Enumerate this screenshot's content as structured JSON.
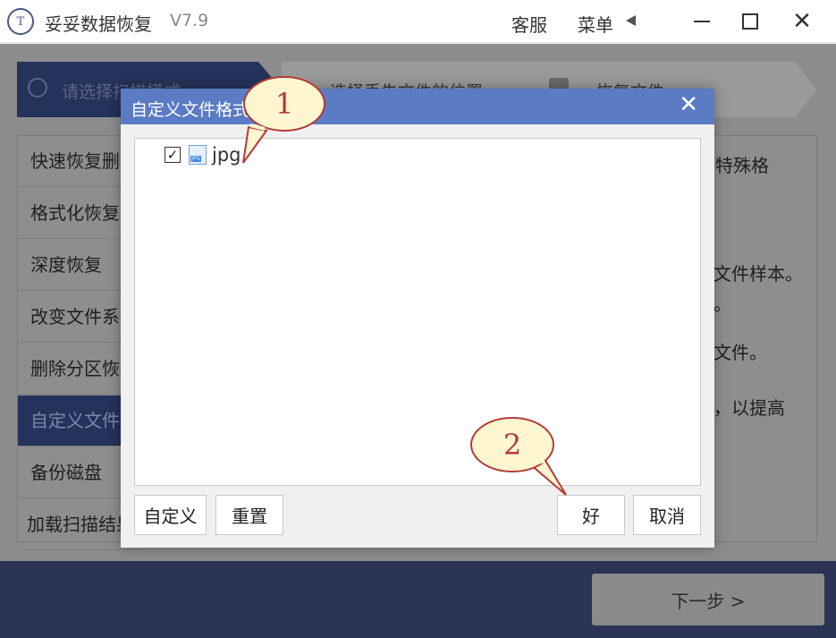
{
  "titlebar": {
    "logo_text": "T",
    "app_name": "妥妥数据恢复",
    "version": "V7.9",
    "support_label": "客服",
    "menu_label": "菜单"
  },
  "steps": [
    {
      "label": "请选择扫描模式"
    },
    {
      "label": "选择丢失文件的位置"
    },
    {
      "label": "恢复文件"
    }
  ],
  "modes": [
    {
      "label": "快速恢复删除的文件"
    },
    {
      "label": "格式化恢复"
    },
    {
      "label": "深度恢复"
    },
    {
      "label": "改变文件系统恢复"
    },
    {
      "label": "删除分区恢复"
    },
    {
      "label": "自定义文件格式恢复"
    },
    {
      "label": "备份磁盘"
    },
    {
      "label": "加载扫描结果"
    }
  ],
  "side_texts": [
    "特殊格",
    "文件样本。",
    "。",
    "文件。",
    "，以提高"
  ],
  "footer": {
    "next_label": "下一步 >"
  },
  "dialog": {
    "title": "自定义文件格式",
    "items": [
      {
        "label": "jpg",
        "checked": true,
        "icon": "jpg-file-icon",
        "icon_text": "JPG"
      }
    ],
    "buttons": {
      "custom": "自定义",
      "reset": "重置",
      "ok": "好",
      "cancel": "取消"
    }
  },
  "callouts": [
    {
      "number": "1"
    },
    {
      "number": "2"
    }
  ],
  "colors": {
    "dialog_header": "#5b7bc4",
    "nav_dark": "#25325a",
    "callout_fill": "#fdf6cf",
    "callout_stroke": "#b33a3a"
  }
}
